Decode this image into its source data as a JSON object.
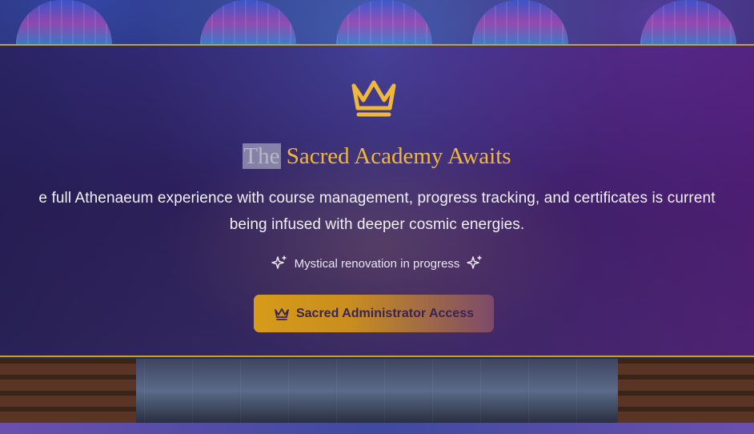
{
  "banner": {
    "title_highlight": "The",
    "title_rest": "Sacred Academy Awaits",
    "description_line1": "e full Athenaeum experience with course management, progress tracking, and certificates is current",
    "description_line2": "being infused with deeper cosmic energies.",
    "status_text": "Mystical renovation in progress",
    "button_label": "Sacred Administrator Access"
  },
  "icons": {
    "crown": "crown-icon",
    "sparkle": "sparkle-icon"
  },
  "colors": {
    "accent_gold": "#f1b73a",
    "border_gold": "#c9a028",
    "button_start": "#d69b18",
    "button_end": "#7c4a6a"
  }
}
